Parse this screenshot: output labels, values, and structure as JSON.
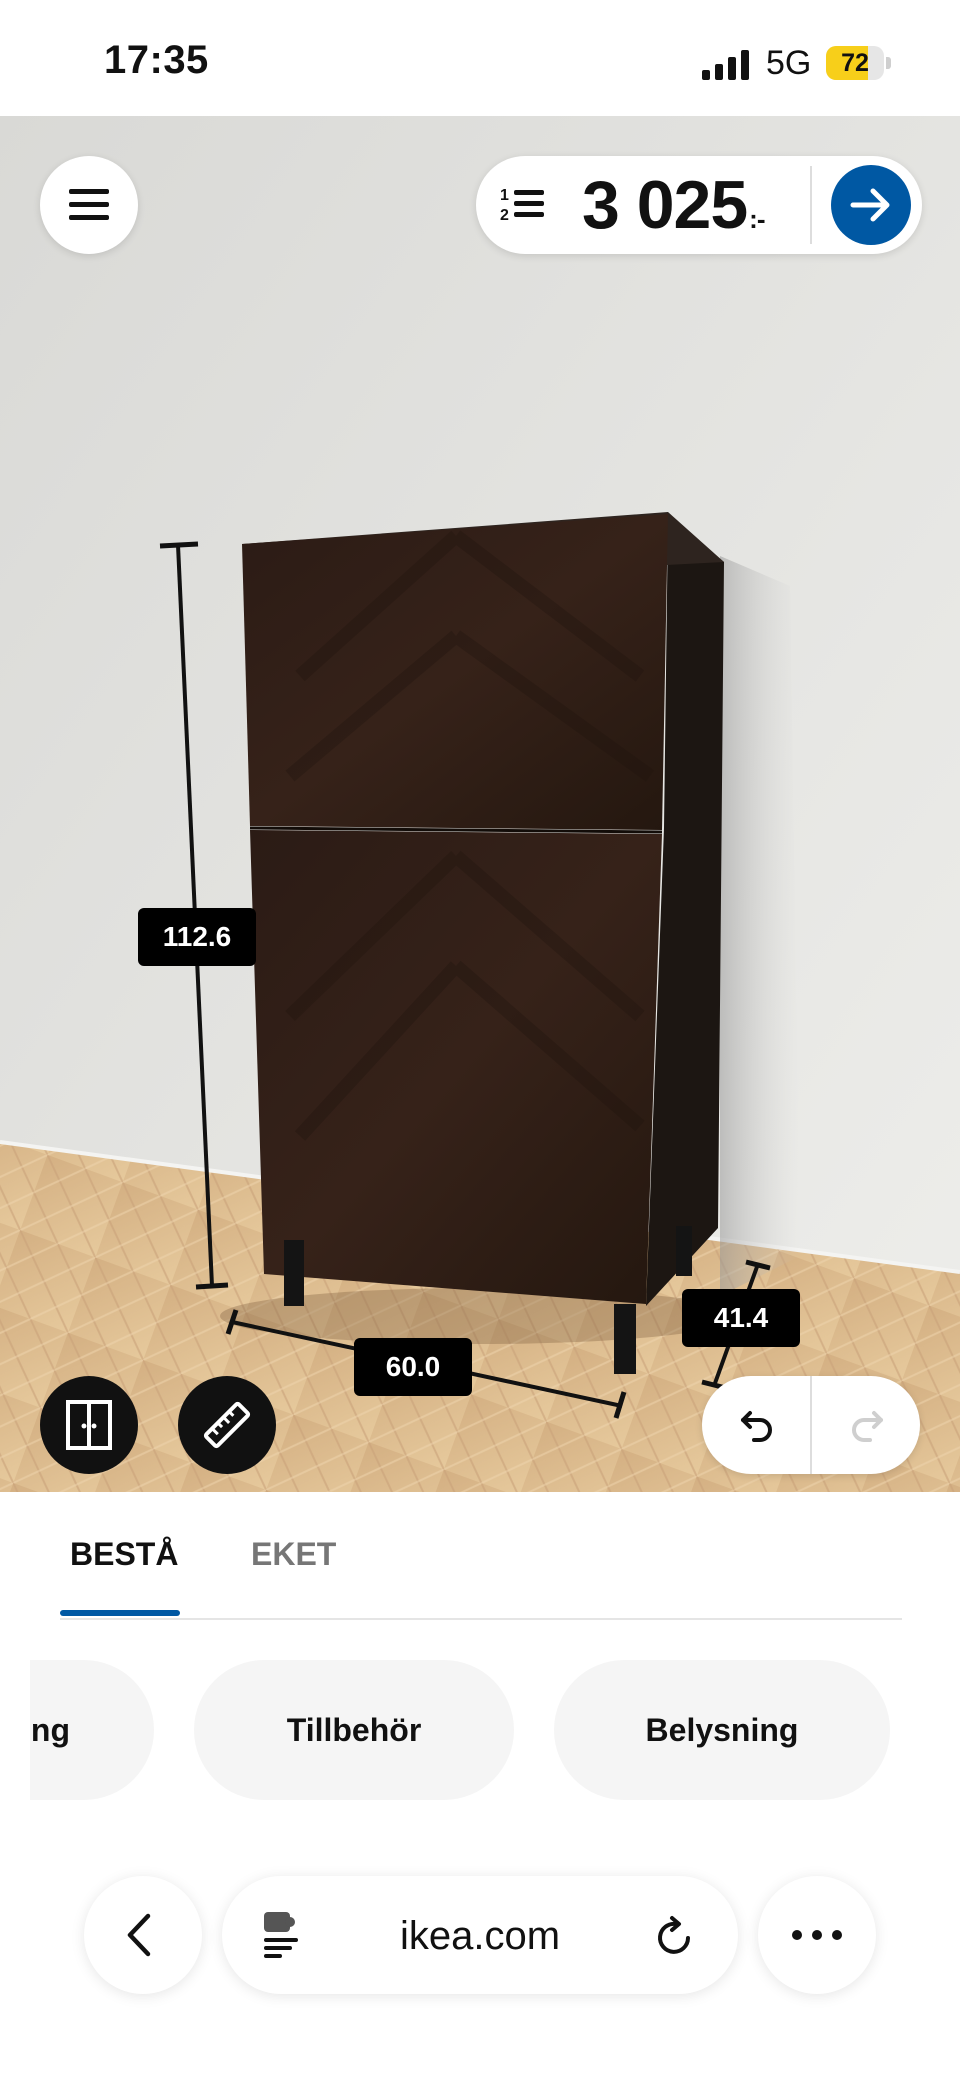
{
  "status_bar": {
    "time": "17:35",
    "network": "5G",
    "battery_percent": "72"
  },
  "top_bar": {
    "menu_icon": "hamburger-menu-icon",
    "list_icon": "numbered-list-icon",
    "price": "3 025",
    "price_suffix": ":-",
    "go_icon": "arrow-right-icon"
  },
  "dimensions": {
    "height": "112.6",
    "width": "60.0",
    "depth": "41.4"
  },
  "tools": {
    "doors_icon": "double-door-icon",
    "measure_icon": "ruler-icon",
    "undo_icon": "undo-icon",
    "redo_icon": "redo-icon"
  },
  "tabs": [
    {
      "label": "BESTÅ",
      "active": true
    },
    {
      "label": "EKET",
      "active": false
    }
  ],
  "chips": [
    {
      "label": "ng"
    },
    {
      "label": "Tillbehör"
    },
    {
      "label": "Belysning"
    }
  ],
  "browser": {
    "url": "ikea.com",
    "back_icon": "chevron-left-icon",
    "site_icon": "site-settings-icon",
    "reload_icon": "reload-icon",
    "more_icon": "more-dots-icon"
  },
  "colors": {
    "ikea_blue": "#0058a3",
    "battery_yellow": "#f7cf1a",
    "cabinet": "#2a1a14"
  }
}
